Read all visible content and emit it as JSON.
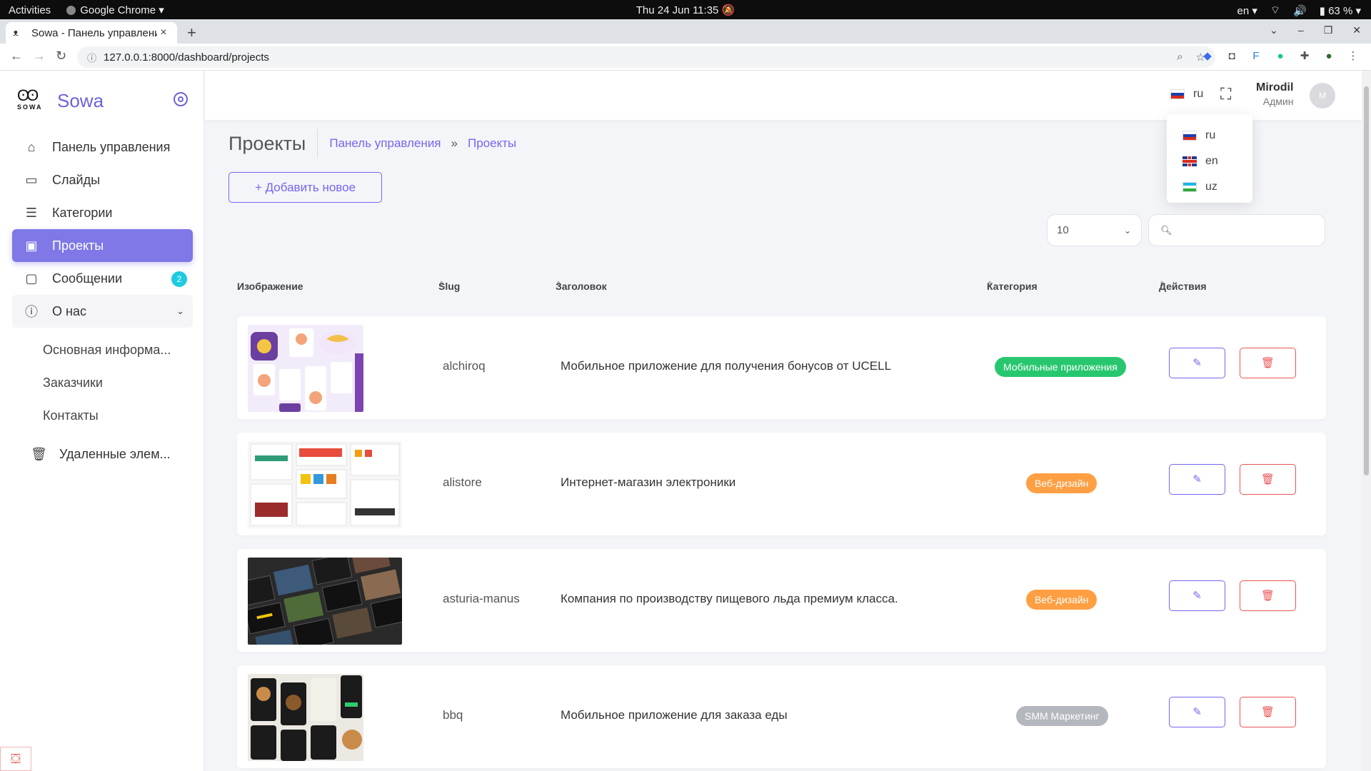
{
  "os_bar": {
    "activities": "Activities",
    "app_name": "Google Chrome",
    "datetime": "Thu 24 Jun  11:35",
    "lang": "en",
    "battery": "63 %"
  },
  "browser": {
    "tab_title": "Sowa - Панель управлени",
    "url": "127.0.0.1:8000/dashboard/projects"
  },
  "brand": {
    "logo_text": "SOWA",
    "name": "Sowa"
  },
  "sidebar": {
    "items": [
      {
        "label": "Панель управления",
        "icon": "home-icon"
      },
      {
        "label": "Слайды",
        "icon": "monitor-icon"
      },
      {
        "label": "Категории",
        "icon": "list-icon"
      },
      {
        "label": "Проекты",
        "icon": "briefcase-icon"
      },
      {
        "label": "Сообщении",
        "icon": "message-icon",
        "badge": "2"
      },
      {
        "label": "О нас",
        "icon": "info-icon"
      }
    ],
    "sub_items": [
      {
        "label": "Основная информа..."
      },
      {
        "label": "Заказчики"
      },
      {
        "label": "Контакты"
      }
    ],
    "trash_label": "Удаленные элем..."
  },
  "topbar": {
    "lang_current": "ru",
    "user_name": "Mirodil",
    "user_role": "Админ",
    "avatar_initial": "M"
  },
  "lang_dropdown": [
    "ru",
    "en",
    "uz"
  ],
  "page": {
    "title": "Проекты",
    "breadcrumb_home": "Панель управления",
    "breadcrumb_sep": "»",
    "breadcrumb_current": "Проекты",
    "add_label": "+ Добавить новое",
    "per_page": "10",
    "search_placeholder": ""
  },
  "table": {
    "headers": [
      "Изображение",
      "Slug",
      "Заголовок",
      "Категория",
      "Действия"
    ],
    "rows": [
      {
        "slug": "alchiroq",
        "title": "Мобильное приложение для получения бонусов от UCELL",
        "category": "Мобильные приложения",
        "category_color": "#28c76f"
      },
      {
        "slug": "alistore",
        "title": "Интернет-магазин электроники",
        "category": "Веб-дизайн",
        "category_color": "#ff9f43"
      },
      {
        "slug": "asturia-manus",
        "title": "Компания по производству пищевого льда премиум класса.",
        "category": "Веб-дизайн",
        "category_color": "#ff9f43"
      },
      {
        "slug": "bbq",
        "title": "Мобильное приложение для заказа еды",
        "category": "SMM Маркетинг",
        "category_color": "#b4b7bd"
      }
    ]
  },
  "colors": {
    "accent": "#7367f0",
    "danger": "#ea5455",
    "badge": "#1ecbe1"
  }
}
